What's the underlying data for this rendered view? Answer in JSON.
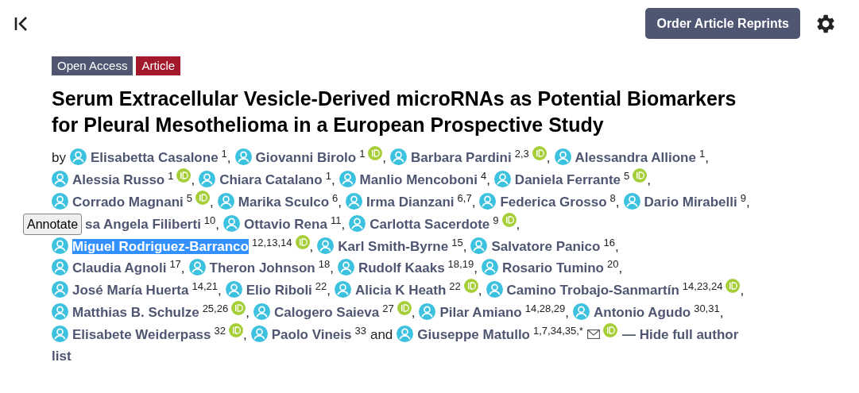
{
  "toolbar": {
    "reprint_button": "Order Article Reprints"
  },
  "badges": [
    {
      "label": "Open Access",
      "kind": "access"
    },
    {
      "label": "Article",
      "kind": "type"
    }
  ],
  "title": "Serum Extracellular Vesicle-Derived microRNAs as Potential Biomarkers for Pleural Mesothelioma in a European Prospective Study",
  "byline": "by",
  "annotate_button": "Annotate",
  "author_lines": [
    [
      {
        "name": "Elisabetta Casalone",
        "aff": "1",
        "orcid": false,
        "sep": ","
      },
      {
        "name": "Giovanni Birolo",
        "aff": "1",
        "orcid": true,
        "sep": ","
      },
      {
        "name": "Barbara Pardini",
        "aff": "2,3",
        "orcid": true,
        "sep": ","
      },
      {
        "name": "Alessandra Allione",
        "aff": "1",
        "orcid": false,
        "sep": ","
      }
    ],
    [
      {
        "name": "Alessia Russo",
        "aff": "1",
        "orcid": true,
        "sep": ","
      },
      {
        "name": "Chiara Catalano",
        "aff": "1",
        "orcid": false,
        "sep": ","
      },
      {
        "name": "Manlio Mencoboni",
        "aff": "4",
        "orcid": false,
        "sep": ","
      },
      {
        "name": "Daniela Ferrante",
        "aff": "5",
        "orcid": true,
        "sep": ","
      }
    ],
    [
      {
        "name": "Corrado Magnani",
        "aff": "5",
        "orcid": true,
        "sep": ","
      },
      {
        "name": "Marika Sculco",
        "aff": "6",
        "orcid": false,
        "sep": ","
      },
      {
        "name": "Irma Dianzani",
        "aff": "6,7",
        "orcid": false,
        "sep": ","
      },
      {
        "name": "Federica Grosso",
        "aff": "8",
        "orcid": false,
        "sep": ","
      },
      {
        "name": "Dario Mirabelli",
        "aff": "9",
        "orcid": false,
        "sep": ","
      }
    ],
    [
      {
        "name": "sa Angela Filiberti",
        "aff": "10",
        "orcid": false,
        "sep": ",",
        "covered": true
      },
      {
        "name": "Ottavio Rena",
        "aff": "11",
        "orcid": false,
        "sep": ","
      },
      {
        "name": "Carlotta Sacerdote",
        "aff": "9",
        "orcid": true,
        "sep": ","
      }
    ],
    [
      {
        "name": "Miguel Rodriguez-Barranco",
        "aff": "12,13,14",
        "orcid": true,
        "sep": ",",
        "highlighted": true
      },
      {
        "name": "Karl Smith-Byrne",
        "aff": "15",
        "orcid": false,
        "sep": ","
      },
      {
        "name": "Salvatore Panico",
        "aff": "16",
        "orcid": false,
        "sep": ","
      }
    ],
    [
      {
        "name": "Claudia Agnoli",
        "aff": "17",
        "orcid": false,
        "sep": ","
      },
      {
        "name": "Theron Johnson",
        "aff": "18",
        "orcid": false,
        "sep": ","
      },
      {
        "name": "Rudolf Kaaks",
        "aff": "18,19",
        "orcid": false,
        "sep": ","
      },
      {
        "name": "Rosario Tumino",
        "aff": "20",
        "orcid": false,
        "sep": ","
      }
    ],
    [
      {
        "name": "José María Huerta",
        "aff": "14,21",
        "orcid": false,
        "sep": ","
      },
      {
        "name": "Elio Riboli",
        "aff": "22",
        "orcid": false,
        "sep": ","
      },
      {
        "name": "Alicia K Heath",
        "aff": "22",
        "orcid": true,
        "sep": ","
      },
      {
        "name": "Camino Trobajo-Sanmartín",
        "aff": "14,23,24",
        "orcid": true,
        "sep": ","
      }
    ],
    [
      {
        "name": "Matthias B. Schulze",
        "aff": "25,26",
        "orcid": true,
        "sep": ","
      },
      {
        "name": "Calogero Saieva",
        "aff": "27",
        "orcid": true,
        "sep": ","
      },
      {
        "name": "Pilar Amiano",
        "aff": "14,28,29",
        "orcid": false,
        "sep": ","
      },
      {
        "name": "Antonio Agudo",
        "aff": "30,31",
        "orcid": false,
        "sep": ","
      }
    ],
    [
      {
        "name": "Elisabete Weiderpass",
        "aff": "32",
        "orcid": true,
        "sep": ","
      },
      {
        "name": "Paolo Vineis",
        "aff": "33",
        "orcid": false,
        "sep": "and"
      },
      {
        "name": "Giuseppe Matullo",
        "aff": "1,7,34,35,*",
        "orcid": true,
        "email": true
      }
    ]
  ],
  "toggle_link_lines": [
    "— Hide full author",
    "list"
  ]
}
